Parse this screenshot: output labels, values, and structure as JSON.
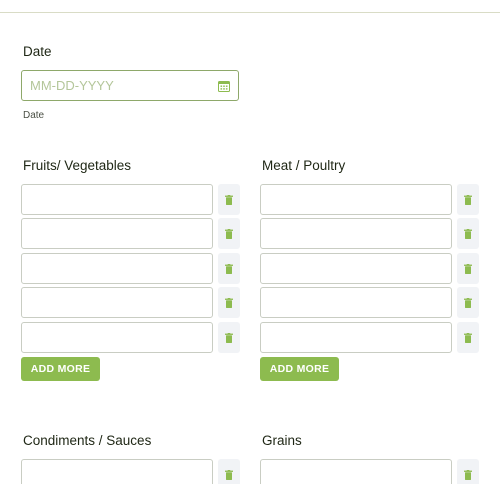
{
  "date": {
    "label": "Date",
    "placeholder": "MM-DD-YYYY",
    "sublabel": "Date",
    "icon": "calendar-icon"
  },
  "sections": {
    "fruits": {
      "label": "Fruits/ Vegetables",
      "add_label": "ADD MORE"
    },
    "meat": {
      "label": "Meat / Poultry",
      "add_label": "ADD MORE"
    },
    "condiments": {
      "label": "Condiments / Sauces"
    },
    "grains": {
      "label": "Grains"
    }
  },
  "icons": {
    "trash": "trash-icon"
  },
  "colors": {
    "accent": "#8dbb4f",
    "icon": "#8dbb4f",
    "border_focus": "#8ea86a"
  }
}
